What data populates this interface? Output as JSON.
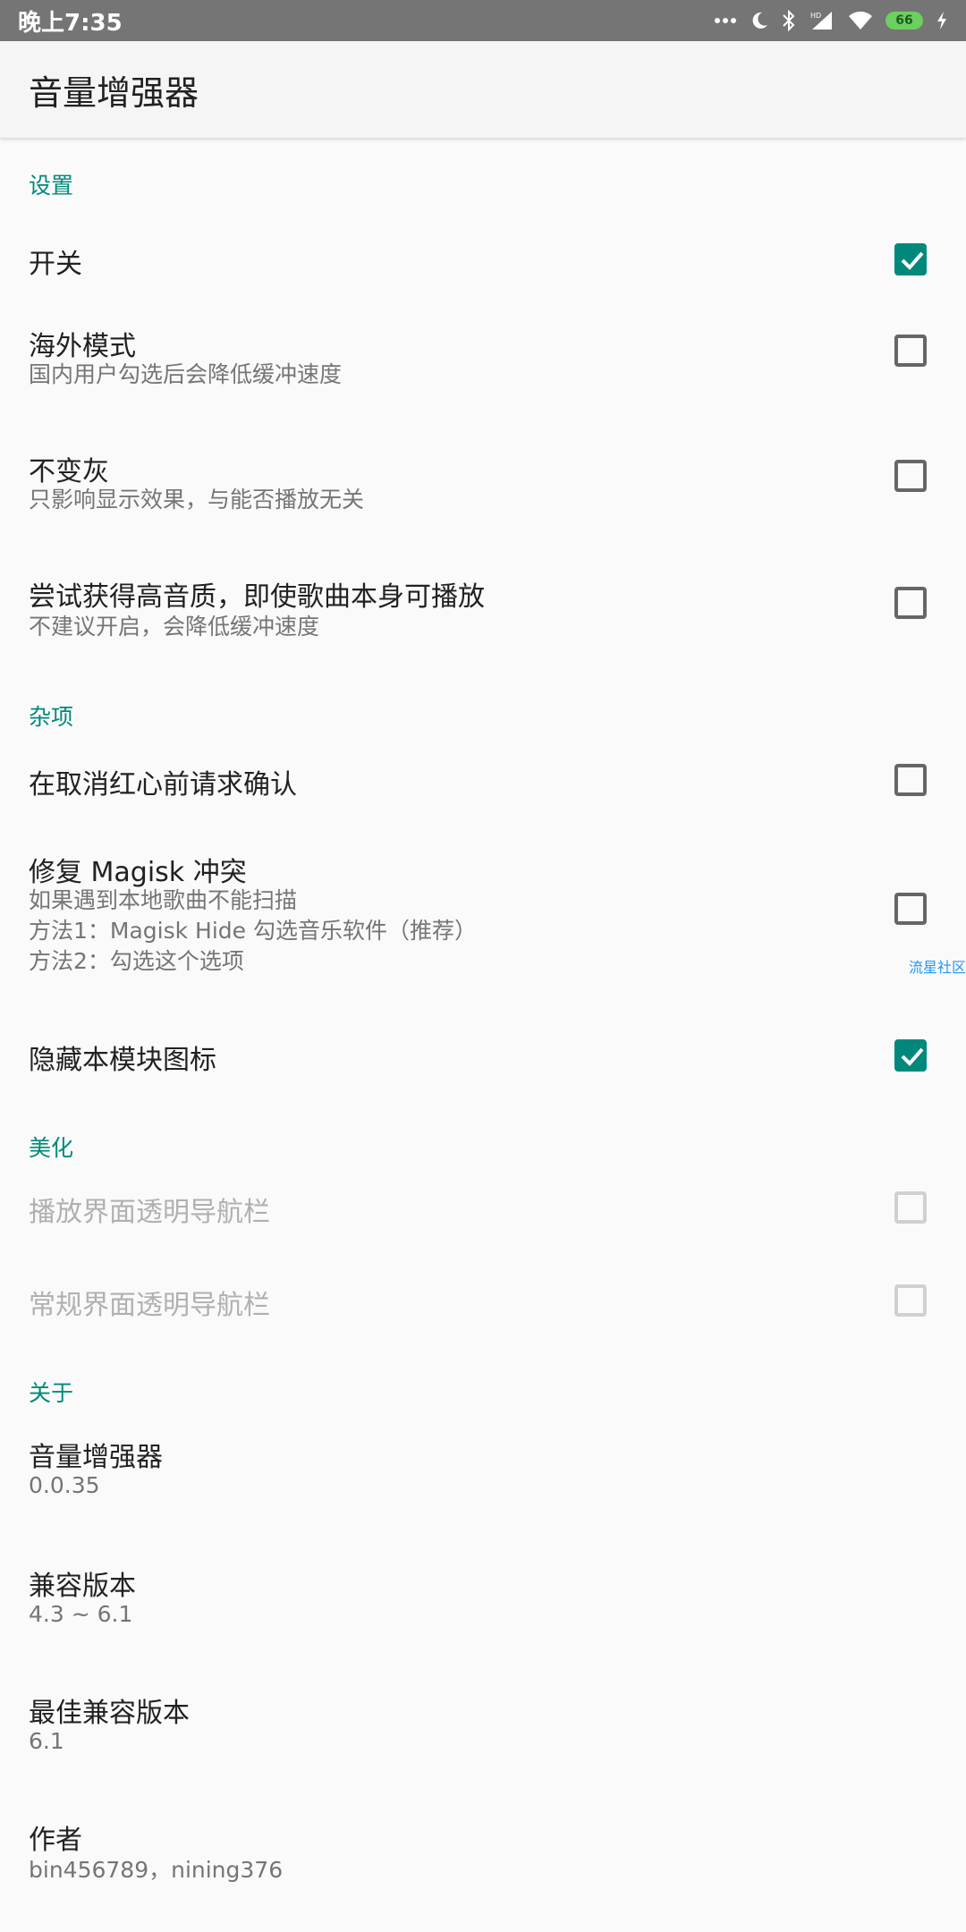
{
  "status_bar": {
    "time": "晚上7:35",
    "battery_level": "66",
    "icons": [
      "more-dots-icon",
      "moon-icon",
      "bluetooth-icon",
      "hd-signal-icon",
      "wifi-icon",
      "battery-icon",
      "charging-icon"
    ]
  },
  "app_bar": {
    "title": "音量增强器"
  },
  "sections": {
    "settings": {
      "header": "设置",
      "switch": {
        "title": "开关",
        "checked": true
      },
      "overseas": {
        "title": "海外模式",
        "summary": "国内用户勾选后会降低缓冲速度",
        "checked": false
      },
      "no_gray": {
        "title": "不变灰",
        "summary": "只影响显示效果，与能否播放无关",
        "checked": false
      },
      "high_quality": {
        "title": "尝试获得高音质，即使歌曲本身可播放",
        "summary": "不建议开启，会降低缓冲速度",
        "checked": false
      }
    },
    "misc": {
      "header": "杂项",
      "confirm_unlike": {
        "title": "在取消红心前请求确认",
        "checked": false
      },
      "magisk": {
        "title": "修复 Magisk 冲突",
        "summary_lines": [
          "如果遇到本地歌曲不能扫描",
          "方法1：Magisk Hide 勾选音乐软件（推荐）",
          "方法2：勾选这个选项"
        ],
        "checked": false
      },
      "hide_icon": {
        "title": "隐藏本模块图标",
        "checked": true
      }
    },
    "beautify": {
      "header": "美化",
      "player_nav": {
        "title": "播放界面透明导航栏",
        "checked": false,
        "enabled": false
      },
      "normal_nav": {
        "title": "常规界面透明导航栏",
        "checked": false,
        "enabled": false
      }
    },
    "about": {
      "header": "关于",
      "app": {
        "title": "音量增强器",
        "summary": "0.0.35"
      },
      "compat": {
        "title": "兼容版本",
        "summary": "4.3 ~ 6.1"
      },
      "best_compat": {
        "title": "最佳兼容版本",
        "summary": "6.1"
      },
      "author": {
        "title": "作者",
        "summary": "bin456789，nining376"
      }
    }
  },
  "watermark": "流星社区",
  "colors": {
    "accent": "#00897b",
    "status_bar": "#757575"
  }
}
